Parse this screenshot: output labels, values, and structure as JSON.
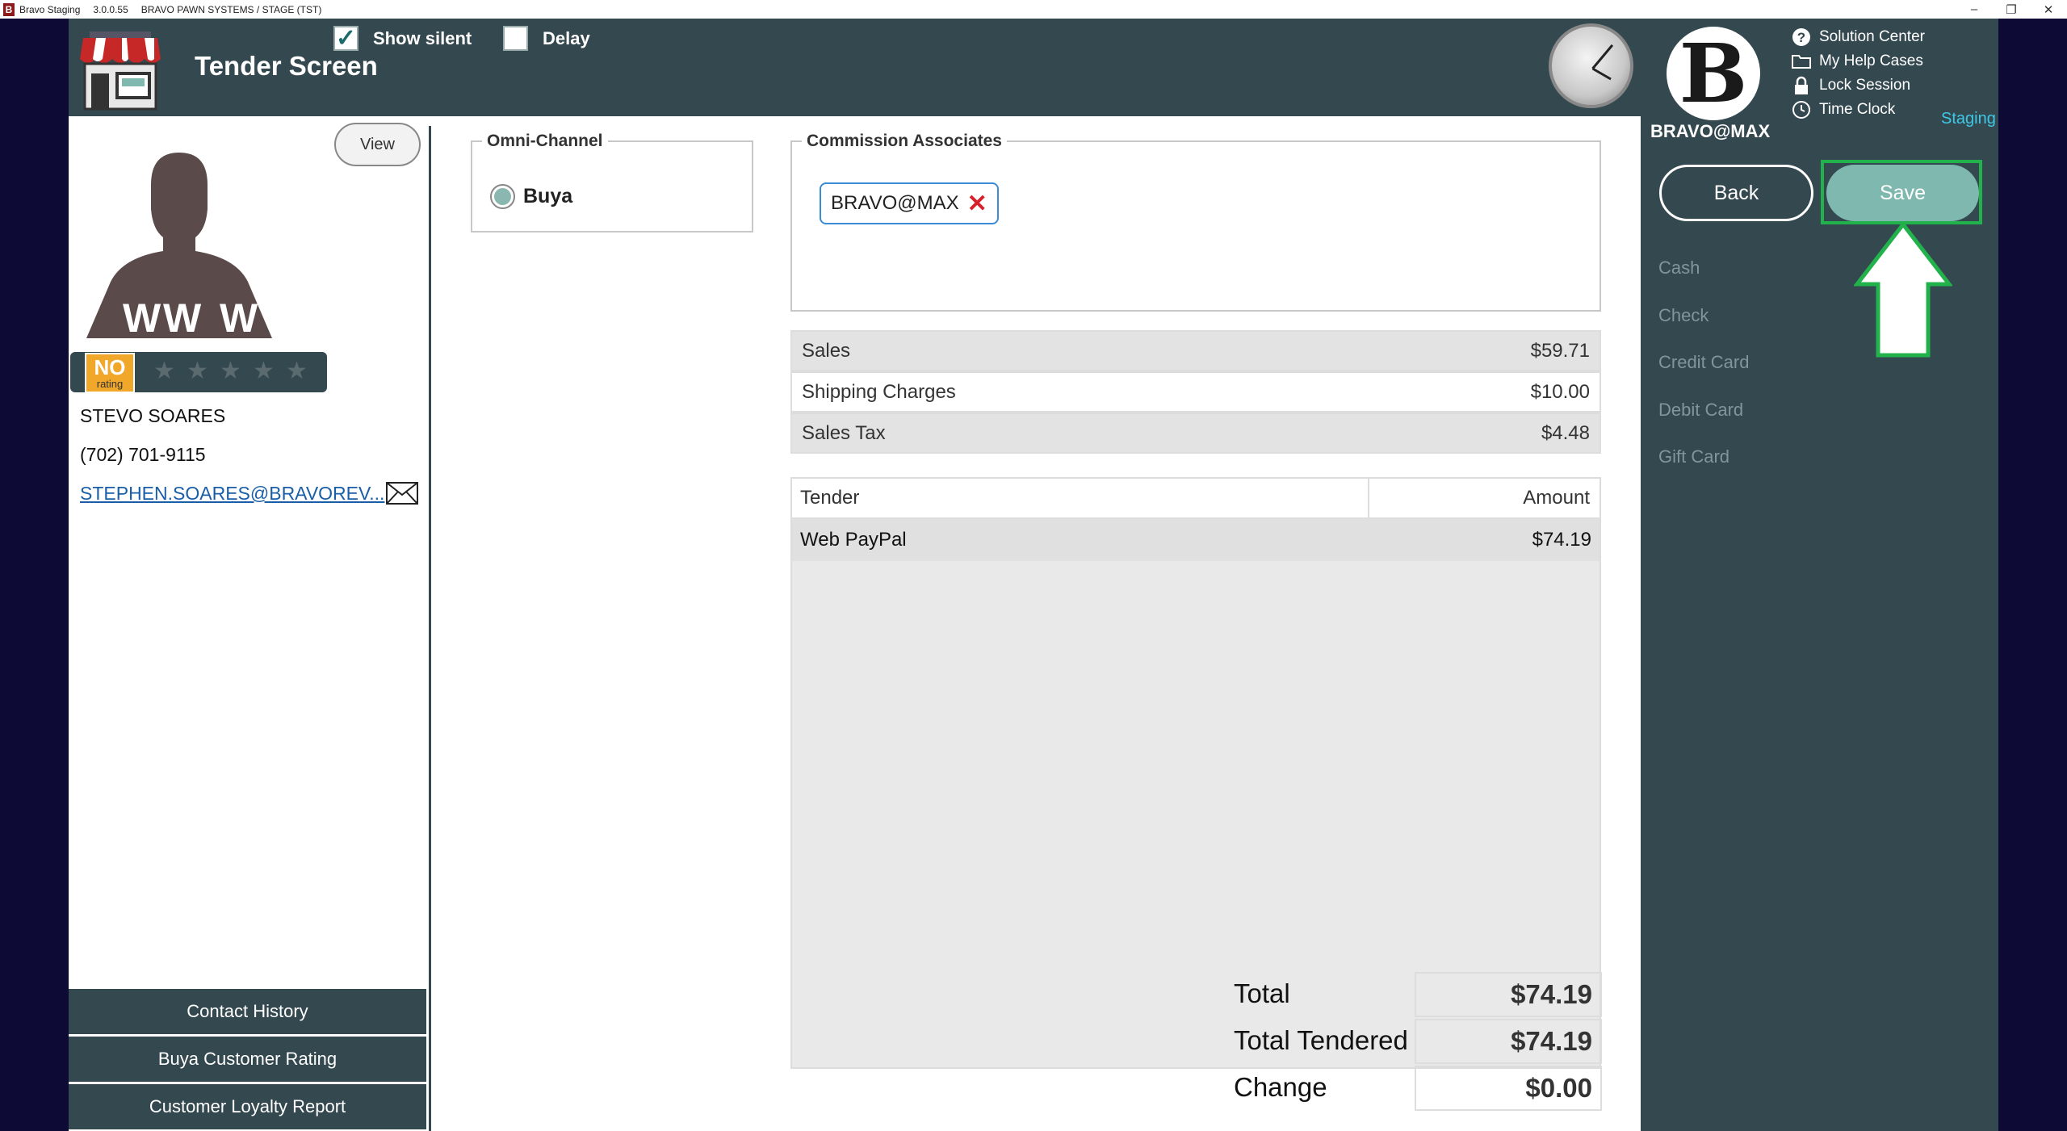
{
  "window": {
    "app_name": "Bravo Staging",
    "version": "3.0.0.55",
    "environment": "BRAVO PAWN SYSTEMS / STAGE (TST)",
    "controls": {
      "minimize": "–",
      "restore": "❐",
      "close": "✕"
    }
  },
  "header": {
    "title": "Tender Screen",
    "show_silent_label": "Show silent",
    "show_silent_checked": true,
    "delay_label": "Delay",
    "delay_checked": false
  },
  "user_panel": {
    "user_name": "BRAVO@MAX",
    "environment_label": "Staging",
    "help_links": [
      "Solution Center",
      "My Help Cases",
      "Lock Session",
      "Time Clock"
    ],
    "back_label": "Back",
    "save_label": "Save",
    "tender_types": [
      "Cash",
      "Check",
      "Credit Card",
      "Debit Card",
      "Gift Card"
    ]
  },
  "customer": {
    "view_label": "View",
    "rating_badge": "NO",
    "rating_caption": "rating",
    "stars": 0,
    "name": "STEVO SOARES",
    "phone": "(702) 701-9115",
    "email": "STEPHEN.SOARES@BRAVOREV...",
    "buttons": [
      "Contact History",
      "Buya Customer Rating",
      "Customer Loyalty Report"
    ]
  },
  "omni_channel": {
    "legend": "Omni-Channel",
    "selected": "Buya"
  },
  "commission": {
    "legend": "Commission Associates",
    "associates": [
      "BRAVO@MAX"
    ]
  },
  "summary": [
    {
      "label": "Sales",
      "value": "$59.71"
    },
    {
      "label": "Shipping Charges",
      "value": "$10.00"
    },
    {
      "label": "Sales Tax",
      "value": "$4.48"
    }
  ],
  "tender_table": {
    "columns": [
      "Tender",
      "Amount"
    ],
    "rows": [
      {
        "tender": "Web PayPal",
        "amount": "$74.19"
      }
    ]
  },
  "totals": {
    "total_label": "Total",
    "total_value": "$74.19",
    "tendered_label": "Total Tendered",
    "tendered_value": "$74.19",
    "change_label": "Change",
    "change_value": "$0.00"
  },
  "colors": {
    "header_bg": "#34484f",
    "save_button": "#7fb8ae",
    "highlight": "#22b24c",
    "staging": "#3ec8e8"
  }
}
